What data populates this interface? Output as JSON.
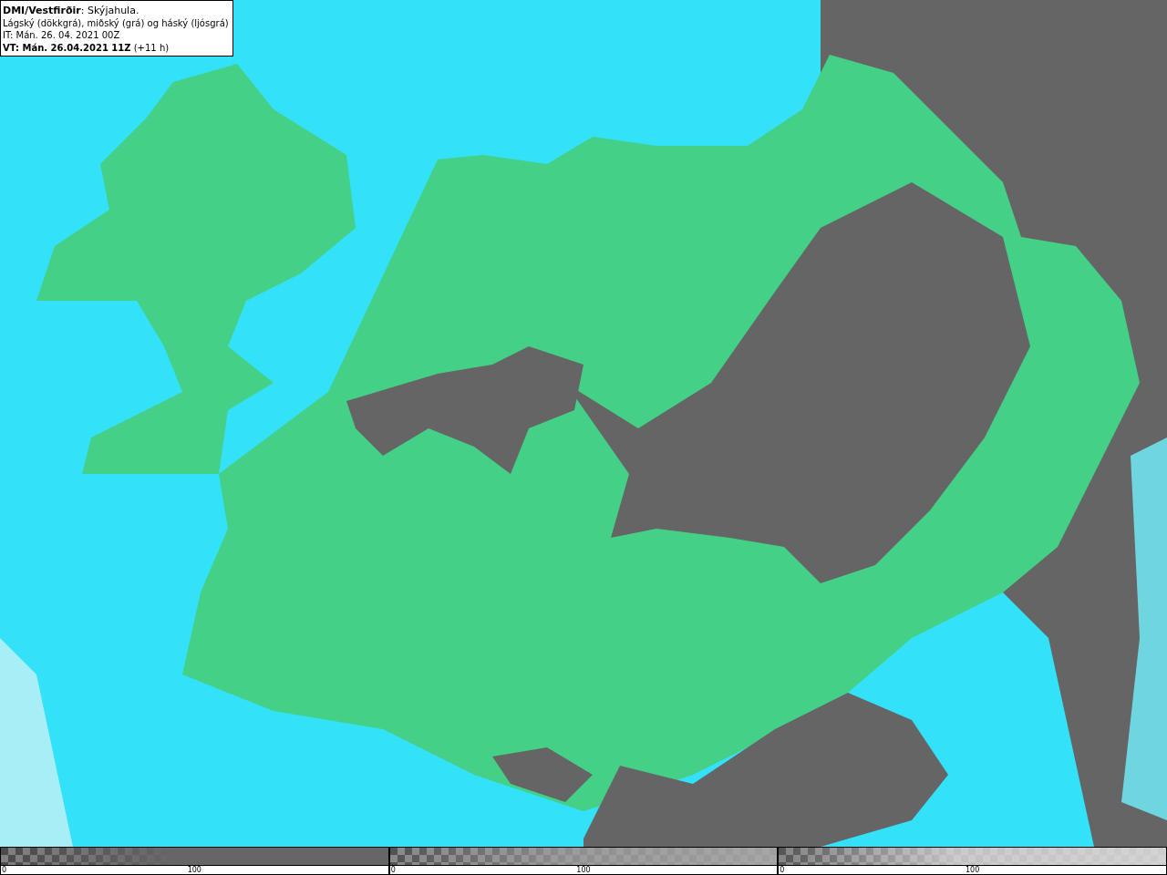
{
  "info_box": {
    "lines": [
      "**DMI/Vestfirðir**: Skýjahula.",
      "Lágský (dökkgrá), miðský (grá) og háský (ljósgrá)",
      "IT: Mán. 26. 04. 2021 00Z",
      "**VT: Mán. 26.04.2021 11Z** (+11 h)"
    ]
  },
  "scales": [
    {
      "kind": "low",
      "min_label": "0",
      "mid_label": "100"
    },
    {
      "kind": "mid",
      "min_label": "0",
      "mid_label": "100"
    },
    {
      "kind": "high",
      "min_label": "0",
      "mid_label": "100"
    }
  ]
}
